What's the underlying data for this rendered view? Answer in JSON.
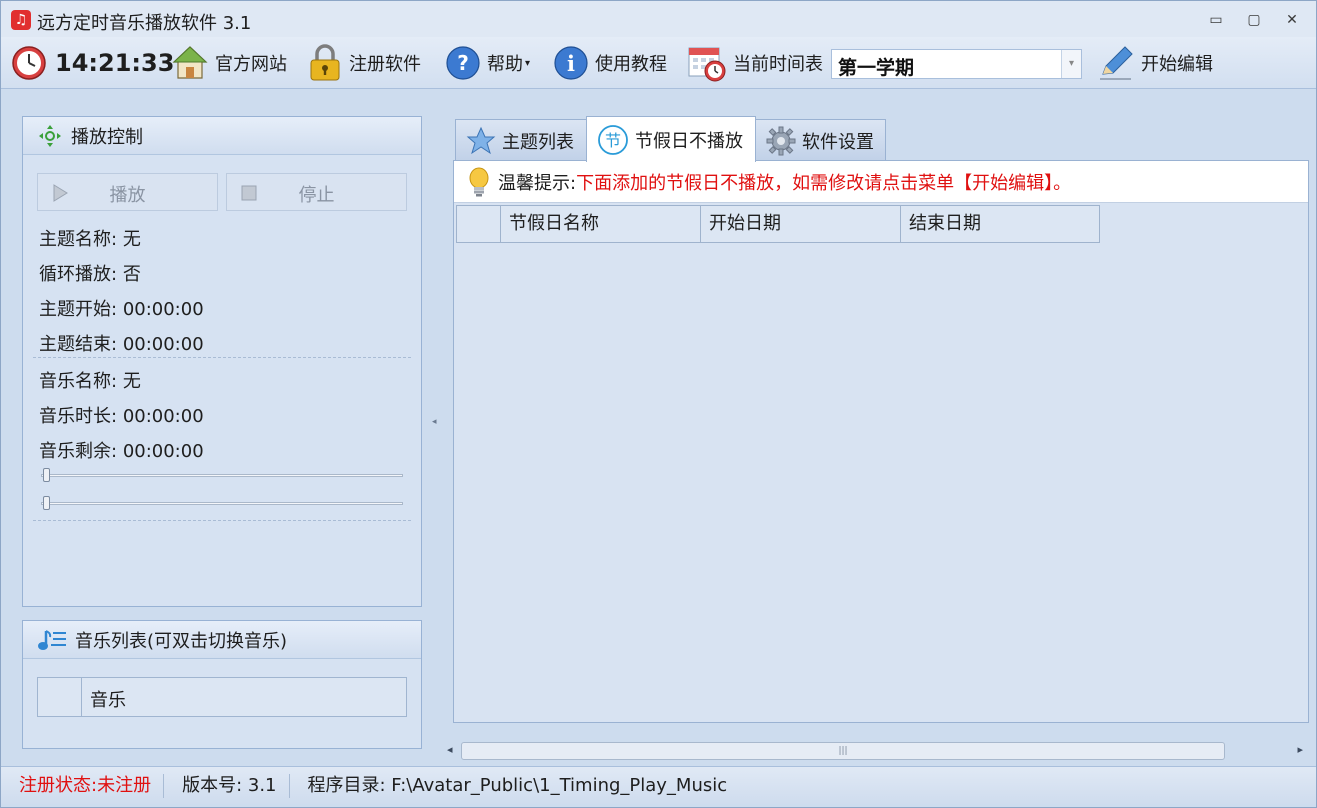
{
  "window": {
    "title": "远方定时音乐播放软件 3.1",
    "controls": [
      "▭",
      "▢",
      "✕"
    ]
  },
  "toolbar": {
    "clock": "14:21:33",
    "official_site": "官方网站",
    "register": "注册软件",
    "help": "帮助",
    "tutorial": "使用教程",
    "current_schedule_label": "当前时间表",
    "current_schedule_value": "第一学期",
    "start_edit": "开始编辑"
  },
  "play_panel": {
    "title": "播放控制",
    "play_label": "播放",
    "stop_label": "停止",
    "theme_name_k": "主题名称:",
    "theme_name_v": "无",
    "loop_k": "循环播放:",
    "loop_v": "否",
    "theme_start_k": "主题开始:",
    "theme_start_v": "00:00:00",
    "theme_end_k": "主题结束:",
    "theme_end_v": "00:00:00",
    "music_name_k": "音乐名称:",
    "music_name_v": "无",
    "music_duration_k": "音乐时长:",
    "music_duration_v": "00:00:00",
    "music_remaining_k": "音乐剩余:",
    "music_remaining_v": "00:00:00",
    "progress_slider_value": 0,
    "volume_slider_value": 0
  },
  "music_panel": {
    "title": "音乐列表(可双击切换音乐)",
    "column": "音乐"
  },
  "tabs": [
    {
      "label": "主题列表",
      "icon": "star-icon"
    },
    {
      "label": "节假日不播放",
      "icon": "holiday-icon",
      "badge": "节"
    },
    {
      "label": "软件设置",
      "icon": "gear-icon"
    }
  ],
  "tip": {
    "label": "温馨提示:",
    "text": "下面添加的节假日不播放，如需修改请点击菜单【开始编辑】。"
  },
  "holiday_table": {
    "columns": [
      "节假日名称",
      "开始日期",
      "结束日期"
    ]
  },
  "status": {
    "reg_state": "注册状态:未注册",
    "version": "版本号: 3.1",
    "directory": "程序目录: F:\\Avatar_Public\\1_Timing_Play_Music"
  },
  "colors": {
    "accent_red": "#e01010",
    "panel_bg": "#d6e2f2",
    "window_bg": "#cddcee"
  }
}
